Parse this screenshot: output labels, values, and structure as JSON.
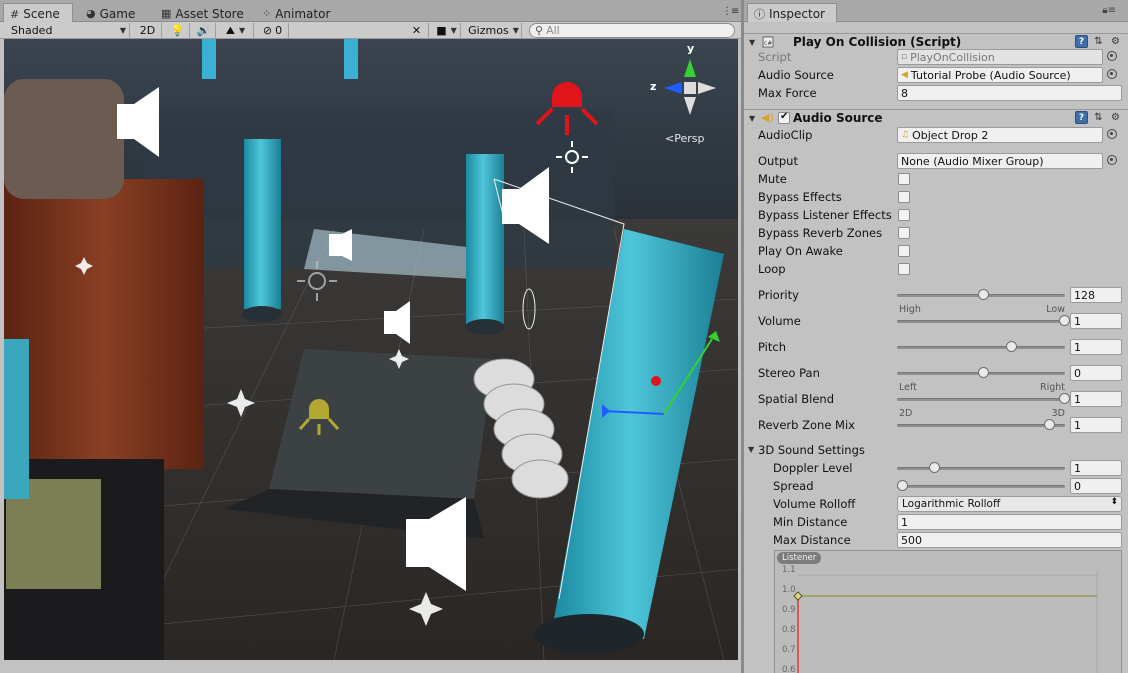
{
  "scene_panel": {
    "tabs": [
      {
        "label": "Scene",
        "icon": "grid-icon"
      },
      {
        "label": "Game",
        "icon": "pacman-icon"
      },
      {
        "label": "Asset Store",
        "icon": "store-icon"
      },
      {
        "label": "Animator",
        "icon": "animator-icon"
      }
    ],
    "toolbar": {
      "draw_mode": "Shaded",
      "mode_2d": "2D",
      "hidden_count": "0",
      "gizmos": "Gizmos",
      "search_placeholder": "All"
    },
    "gizmo": {
      "axis_y": "y",
      "axis_z": "z",
      "projection": "Persp"
    }
  },
  "inspector": {
    "tab_label": "Inspector",
    "tab_icon": "info-icon",
    "play_on_collision": {
      "title": "Play On Collision (Script)",
      "script_label": "Script",
      "script_value": "PlayOnCollision",
      "audio_source_label": "Audio Source",
      "audio_source_value": "Tutorial Probe (Audio Source)",
      "max_force_label": "Max Force",
      "max_force_value": "8"
    },
    "audio_source": {
      "title": "Audio Source",
      "enabled": true,
      "audioclip_label": "AudioClip",
      "audioclip_value": "Object Drop 2",
      "output_label": "Output",
      "output_value": "None (Audio Mixer Group)",
      "toggles": [
        {
          "label": "Mute",
          "checked": false
        },
        {
          "label": "Bypass Effects",
          "checked": false
        },
        {
          "label": "Bypass Listener Effects",
          "checked": false
        },
        {
          "label": "Bypass Reverb Zones",
          "checked": false
        },
        {
          "label": "Play On Awake",
          "checked": false
        },
        {
          "label": "Loop",
          "checked": false
        }
      ],
      "sliders": [
        {
          "label": "Priority",
          "value": "128",
          "fraction": 0.5,
          "min_caption": "High",
          "max_caption": "Low"
        },
        {
          "label": "Volume",
          "value": "1",
          "fraction": 1.0
        },
        {
          "label": "Pitch",
          "value": "1",
          "fraction": 0.67
        },
        {
          "label": "Stereo Pan",
          "value": "0",
          "fraction": 0.5,
          "min_caption": "Left",
          "max_caption": "Right"
        },
        {
          "label": "Spatial Blend",
          "value": "1",
          "fraction": 1.0,
          "min_caption": "2D",
          "max_caption": "3D"
        },
        {
          "label": "Reverb Zone Mix",
          "value": "1",
          "fraction": 0.91
        }
      ],
      "sound3d": {
        "header": "3D Sound Settings",
        "doppler_label": "Doppler Level",
        "doppler_value": "1",
        "doppler_fraction": 0.2,
        "spread_label": "Spread",
        "spread_value": "0",
        "spread_fraction": 0.0,
        "rolloff_label": "Volume Rolloff",
        "rolloff_value": "Logarithmic Rolloff",
        "min_distance_label": "Min Distance",
        "min_distance_value": "1",
        "max_distance_label": "Max Distance",
        "max_distance_value": "500"
      },
      "curve": {
        "legend": "Listener",
        "y_ticks": [
          "1.1",
          "1.0",
          "0.9",
          "0.8",
          "0.7",
          "0.6"
        ]
      }
    }
  },
  "colors": {
    "panel_bg": "#c2c2c2",
    "tabbar_bg": "#a8a8a8",
    "help_blue": "#3f6ea8",
    "water_cyan": "#3fb3c9",
    "gizmo_red": "#e0141a"
  }
}
